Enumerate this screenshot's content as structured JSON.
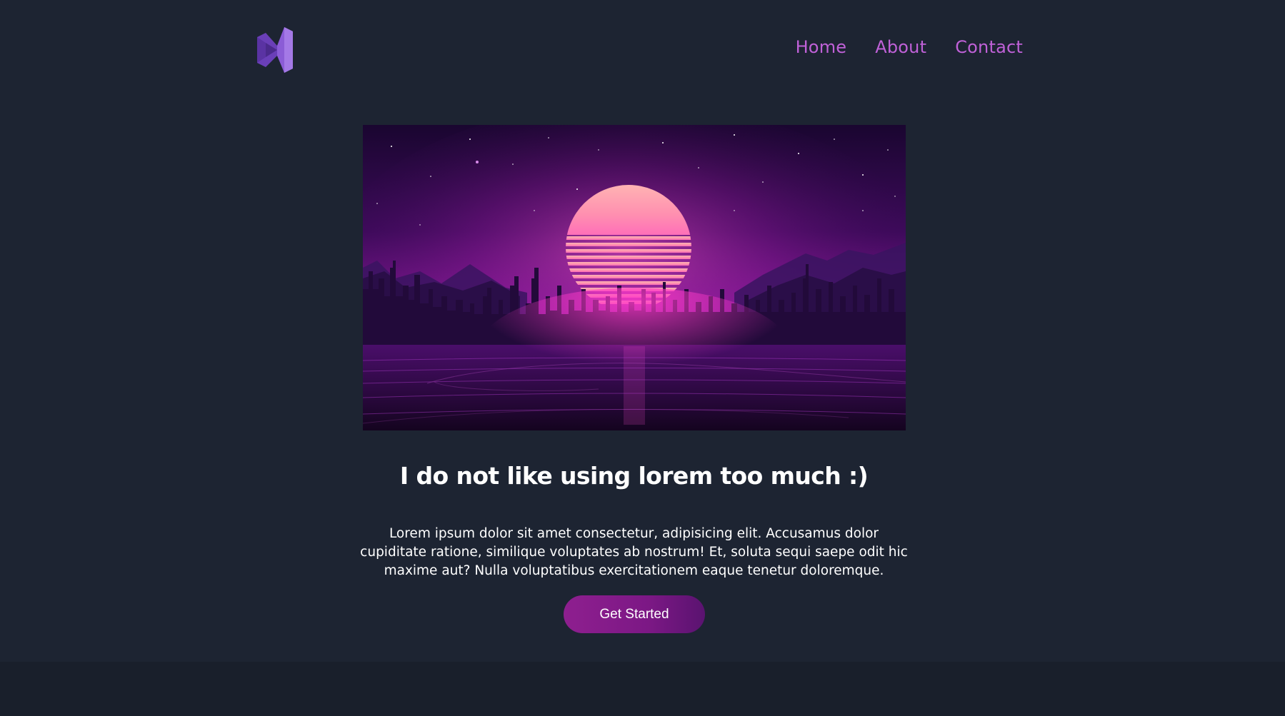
{
  "nav": {
    "logo_icon": "visual-studio-logo-icon",
    "items": [
      {
        "label": "Home"
      },
      {
        "label": "About"
      },
      {
        "label": "Contact"
      }
    ]
  },
  "hero": {
    "image_icon": "synthwave-city-sunset-image"
  },
  "content": {
    "headline": "I do not like using lorem too much :)",
    "body": "Lorem ipsum dolor sit amet consectetur, adipisicing elit. Accusamus dolor cupiditate ratione, similique voluptates ab nostrum! Et, soluta sequi saepe odit hic maxime aut? Nulla voluptatibus exercitationem eaque tenetur doloremque.",
    "cta_label": "Get Started"
  },
  "colors": {
    "background": "#1d2432",
    "footer": "#191f2b",
    "nav_link": "#c061d8",
    "logo": "#8b5cd6",
    "button_start": "#8e1f8f",
    "button_end": "#5a1370"
  }
}
